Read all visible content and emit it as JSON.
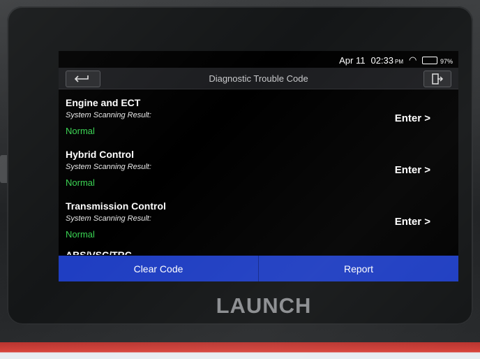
{
  "status_bar": {
    "date": "Apr 11",
    "time": "02:33",
    "ampm": "PM",
    "battery": "97%",
    "wifi_icon": "wifi-icon",
    "battery_icon": "battery-icon"
  },
  "header": {
    "title": "Diagnostic Trouble Code",
    "back_icon": "back-arrow-icon",
    "exit_icon": "exit-icon"
  },
  "systems": [
    {
      "name": "Engine and ECT",
      "label": "System Scanning Result:",
      "status": "Normal",
      "action": "Enter >"
    },
    {
      "name": "Hybrid Control",
      "label": "System Scanning Result:",
      "status": "Normal",
      "action": "Enter >"
    },
    {
      "name": "Transmission Control",
      "label": "System Scanning Result:",
      "status": "Normal",
      "action": "Enter >"
    },
    {
      "name": "ABS/VSC/TRC"
    }
  ],
  "footer": {
    "clear_label": "Clear Code",
    "report_label": "Report"
  },
  "device": {
    "brand": "LAUNCH"
  },
  "colors": {
    "status_ok": "#39d452",
    "footer_bar": "#1f3ec2",
    "device_accent": "#d8453d"
  }
}
